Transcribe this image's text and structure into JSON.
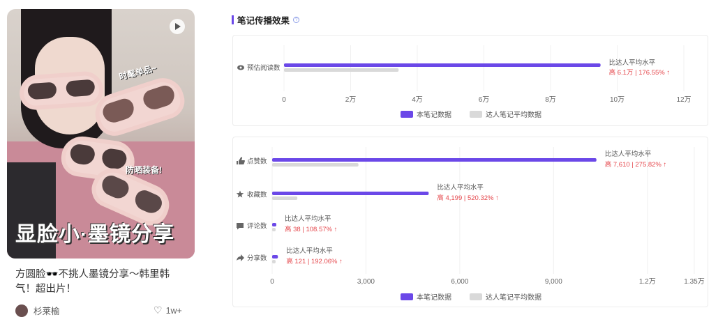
{
  "post": {
    "cover_title": "显脸小·墨镜分享",
    "sticker_1": "时髦单品~",
    "sticker_2": "防晒装备!",
    "title": "方圆脸🕶️不挑人墨镜分享～韩里韩气！超出片！",
    "author": "杉莱榆",
    "likes": "1w+"
  },
  "section": {
    "title": "笔记传播效果"
  },
  "chart_data": [
    {
      "type": "bar",
      "orientation": "horizontal",
      "categories": [
        "预估阅读数"
      ],
      "series": [
        {
          "name": "本笔记数据",
          "values": [
            95000
          ],
          "color": "#6b48e8"
        },
        {
          "name": "达人笔记平均数据",
          "values": [
            34400
          ],
          "color": "#d9d9d9"
        }
      ],
      "annotations": [
        {
          "label": "比达人平均水平",
          "delta": "高 6.1万 | 176.55% ↑"
        }
      ],
      "xlim": [
        0,
        120000
      ],
      "xticks": [
        0,
        20000,
        40000,
        60000,
        80000,
        100000,
        120000
      ],
      "xtick_labels": [
        "0",
        "2万",
        "4万",
        "6万",
        "8万",
        "10万",
        "12万"
      ],
      "legend": "bottom",
      "grid": "vertical"
    },
    {
      "type": "bar",
      "orientation": "horizontal",
      "categories": [
        "点赞数",
        "收藏数",
        "评论数",
        "分享数"
      ],
      "icons": [
        "thumb-up-icon",
        "star-icon",
        "comment-icon",
        "share-icon"
      ],
      "series": [
        {
          "name": "本笔记数据",
          "values": [
            10370,
            5006,
            73,
            184
          ],
          "color": "#6b48e8"
        },
        {
          "name": "达人笔记平均数据",
          "values": [
            2760,
            807,
            35,
            63
          ],
          "color": "#d9d9d9"
        }
      ],
      "annotations": [
        {
          "label": "比达人平均水平",
          "delta": "高 7,610 | 275.82% ↑"
        },
        {
          "label": "比达人平均水平",
          "delta": "高 4,199 | 520.32% ↑"
        },
        {
          "label": "比达人平均水平",
          "delta": "高 38 | 108.57% ↑"
        },
        {
          "label": "比达人平均水平",
          "delta": "高 121 | 192.06% ↑"
        }
      ],
      "xlim": [
        0,
        13500
      ],
      "xticks": [
        0,
        3000,
        6000,
        9000,
        12000,
        13500
      ],
      "xtick_labels": [
        "0",
        "3,000",
        "6,000",
        "9,000",
        "1.2万",
        "1.35万"
      ],
      "legend": "bottom",
      "grid": "vertical"
    }
  ],
  "colors": {
    "accent": "#6b48e8",
    "avg": "#d9d9d9",
    "up": "#e5484d"
  }
}
